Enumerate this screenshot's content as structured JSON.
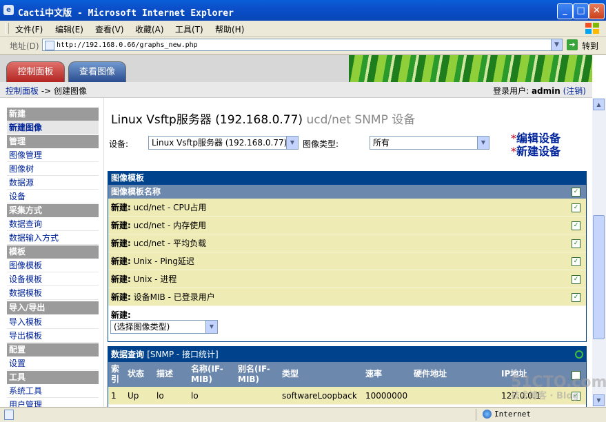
{
  "window": {
    "title": "Cacti中文版 - Microsoft Internet Explorer",
    "min": "_",
    "max": "□",
    "close": "✕"
  },
  "menu": [
    "文件(F)",
    "编辑(E)",
    "查看(V)",
    "收藏(A)",
    "工具(T)",
    "帮助(H)"
  ],
  "address": {
    "label": "地址(D)",
    "url": "http://192.168.0.66/graphs_new.php",
    "go": "转到"
  },
  "tabs": {
    "console": "控制面板",
    "graphs": "查看图像"
  },
  "breadcrumb": {
    "home": "控制面板",
    "sep": " -> ",
    "current": "创建图像"
  },
  "login": {
    "prefix": "登录用户: ",
    "user": "admin",
    "logout": "(注销)"
  },
  "sidebar": {
    "h_new": "新建",
    "new_graphs": "新建图像",
    "h_manage": "管理",
    "graph_mgmt": "图像管理",
    "graph_trees": "图像树",
    "data_sources": "数据源",
    "devices": "设备",
    "h_collect": "采集方式",
    "data_queries": "数据查询",
    "data_input": "数据输入方式",
    "h_templates": "模板",
    "graph_templates": "图像模板",
    "host_templates": "设备模板",
    "data_templates": "数据模板",
    "h_importexport": "导入/导出",
    "import_templates": "导入模板",
    "export_templates": "导出模板",
    "h_config": "配置",
    "settings": "设置",
    "h_utilities": "工具",
    "system_utilities": "系统工具",
    "user_mgmt": "用户管理"
  },
  "device": {
    "title": "Linux Vsftp服务器 (192.168.0.77)",
    "subtitle": "ucd/net SNMP 设备",
    "device_label": "设备:",
    "device_value": "Linux Vsftp服务器 (192.168.0.77)",
    "graph_type_label": "图像类型:",
    "graph_type_value": "所有",
    "edit_link": "编辑设备",
    "new_link": "新建设备"
  },
  "templates": {
    "header": "图像模板",
    "col_name": "图像模板名称",
    "new_prefix": "新建:",
    "rows": [
      "ucd/net - CPU占用",
      "ucd/net - 内存使用",
      "ucd/net - 平均负载",
      "Unix - Ping延迟",
      "Unix - 进程",
      "设备MIB - 已登录用户"
    ],
    "footer_label": "新建:",
    "select_placeholder": "(选择图像类型)"
  },
  "data_query": {
    "header_bold": "数据查询",
    "header_name": "[SNMP - 接口统计]",
    "columns": [
      "索引",
      "状态",
      "描述",
      "名称(IF-MIB)",
      "别名(IF-MIB)",
      "类型",
      "速率",
      "硬件地址",
      "IP地址"
    ],
    "row1": [
      "1",
      "Up",
      "lo",
      "lo",
      "",
      "softwareLoopback",
      "10000000",
      "",
      "127.0.0.1"
    ]
  },
  "status": {
    "zone": "Internet"
  },
  "watermark": {
    "line1": "51CTO.com",
    "line2": "技术博客 · Blog"
  }
}
